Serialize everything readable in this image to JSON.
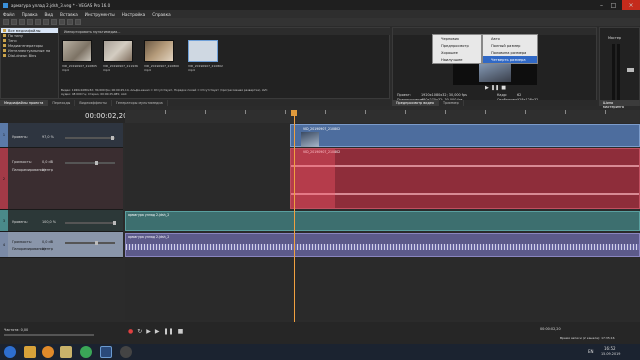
{
  "window": {
    "title": "армагура уллад 2.jdsh_3.veg * - VEGAS Pro 16.0"
  },
  "menu": [
    "Файл",
    "Правка",
    "Вид",
    "Вставка",
    "Инструменты",
    "Настройка",
    "Справка"
  ],
  "explorer": {
    "items": [
      "Все медиафайлы",
      "По типу",
      "Теги",
      "Медиагенераторы",
      "Интеллектуальные па",
      "Dial-drawn Bins"
    ],
    "media": [
      {
        "name": "VID_20190907_210805",
        "ext": "mp4"
      },
      {
        "name": "VID_20190907_211936",
        "ext": "mp4"
      },
      {
        "name": "VID_20190907_210800",
        "ext": "mp4"
      },
      {
        "name": "VID_20190907_210802",
        "ext": "mp4"
      }
    ],
    "header": "Импортировать мультимедиа...",
    "info1": "Видео: 1920x1080x32; 30,000 fps; 00:00:25,14, Альфа-канал = Отсутствует, Порядок полей = Отсутствует (прогрессивная развертка), AVC",
    "info2": "Аудио: 48 000 Гц; Стерео; 00:00:25,085; AAC"
  },
  "bottom_tabs": [
    "Медиафайлы проекта",
    "Переходы",
    "Видеоэффекты",
    "Генераторы мультимедиа"
  ],
  "preview": {
    "project": "Проект:",
    "project_val": "1920x1080x32; 30,000 fps",
    "frame": "Кадр:",
    "frame_val": "62",
    "preview_l": "Предпросмотр:",
    "preview_val": "480x270x32; 30,000 fps",
    "display": "Отобразить:",
    "display_val": "128x128x32",
    "tabs": [
      "Предпросмотр видео",
      "Триммер"
    ],
    "mixer_label": "Мастер",
    "mixer_tab": "Шина мастеринга"
  },
  "context_menu": {
    "items": [
      "Черновик",
      "Предпросмотр",
      "Хорошее",
      "Наилучшее"
    ],
    "sub": [
      "Авто",
      "Полный размер",
      "Половина размера",
      "Четверть размера"
    ]
  },
  "timeline": {
    "timecode": "00:00:02,20",
    "tracks": [
      {
        "num": "1",
        "label": "Уровень:",
        "value": "97,0 %",
        "color": "#5b7aa8"
      },
      {
        "num": "2",
        "label": "Громкость:",
        "value": "0,0 dB",
        "pan": "Панорамирование:",
        "pan_val": "Центр",
        "color": "#a33a47"
      },
      {
        "num": "3",
        "label": "Уровень:",
        "value": "100,0 %",
        "color": "#4a8a8a"
      },
      {
        "num": "4",
        "label": "Громкость:",
        "value": "0,0 dB",
        "pan": "Панорамирование:",
        "pan_val": "Центр",
        "color": "#7a8aa6"
      }
    ],
    "clips": [
      {
        "name": "VID_20190907_210802"
      },
      {
        "name": "VID_20190907_210802"
      },
      {
        "name": "армагура уллад 2.jdsh_2"
      },
      {
        "name": "армагура уллад 2.jdsh_2"
      }
    ],
    "rate": "Частота: 0,00",
    "bottom_time": "00:00:02,20",
    "record_time": "Время записи (2 канала): 17:35:16"
  },
  "taskbar": {
    "lang": "EN",
    "time": "16:52",
    "date": "15.09.2019"
  }
}
